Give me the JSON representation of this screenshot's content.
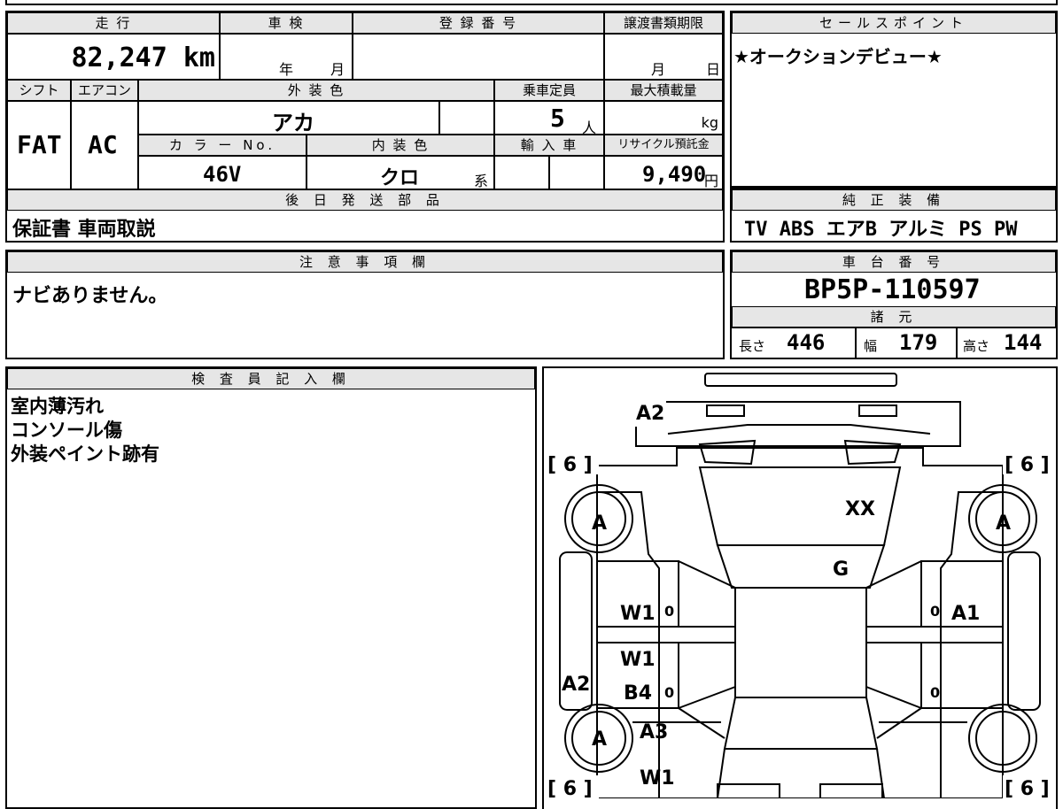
{
  "header": {
    "mileage_label": "走 行",
    "inspection_label": "車 検",
    "registration_label": "登 録 番 号",
    "transfer_label": "譲渡書類期限",
    "sales_point_label": "セールスポイント",
    "shift_label": "シフト",
    "ac_label": "エアコン",
    "exterior_color_label": "外 装 色",
    "capacity_label": "乗車定員",
    "max_load_label": "最大積載量",
    "color_no_label": "カ ラ ー No.",
    "interior_color_label": "内 装 色",
    "import_label": "輸 入 車",
    "recycle_label": "リサイクル預託金",
    "later_parts_label": "後 日 発 送 部 品",
    "genuine_equipment_label": "純 正 装 備",
    "notes_label": "注 意 事 項 欄",
    "chassis_label": "車 台 番 号",
    "specs_label": "諸 元",
    "inspector_label": "検 査 員 記 入 欄"
  },
  "values": {
    "mileage": "82,247 km",
    "inspection_year_unit": "年",
    "inspection_month_unit": "月",
    "transfer_month_unit": "月",
    "transfer_day_unit": "日",
    "sales_point": "★オークションデビュー★",
    "shift": "FAT",
    "ac": "AC",
    "exterior_color": "アカ",
    "capacity": "5",
    "capacity_unit": "人",
    "max_load_unit": "kg",
    "color_no": "46V",
    "interior_color": "クロ",
    "interior_suffix": "系",
    "recycle_fee": "9,490",
    "recycle_unit": "円",
    "later_parts": "保証書 車両取説",
    "genuine_equipment": "TV ABS エアB アルミ PS PW",
    "notes": "ナビありません。",
    "chassis_number": "BP5P-110597",
    "length_label": "長さ",
    "length": "446",
    "width_label": "幅",
    "width": "179",
    "height_label": "高さ",
    "height": "144",
    "inspector_line1": "室内薄汚れ",
    "inspector_line2": "コンソール傷",
    "inspector_line3": "外装ペイント跡有"
  },
  "diagram": {
    "codes": {
      "front_bumper": "A2",
      "hood": "XX",
      "windshield": "G",
      "tire_fl": "A",
      "tire_fr": "A",
      "tire_rl": "A",
      "front_door_l": "W1",
      "front_door_r": "A1",
      "rear_door_l_1": "W1",
      "rear_door_l_2": "B4",
      "side_sill_l": "A2",
      "rear_fender_l": "A3",
      "rear_l": "W1",
      "zero_a": "0",
      "zero_b": "0",
      "zero_c": "0",
      "zero_d": "0"
    },
    "tire_depth_fl": "[ 6 ]",
    "tire_depth_fr": "[ 6 ]",
    "tire_depth_rl": "[ 6 ]",
    "tire_depth_rr": "[ 6 ]"
  }
}
